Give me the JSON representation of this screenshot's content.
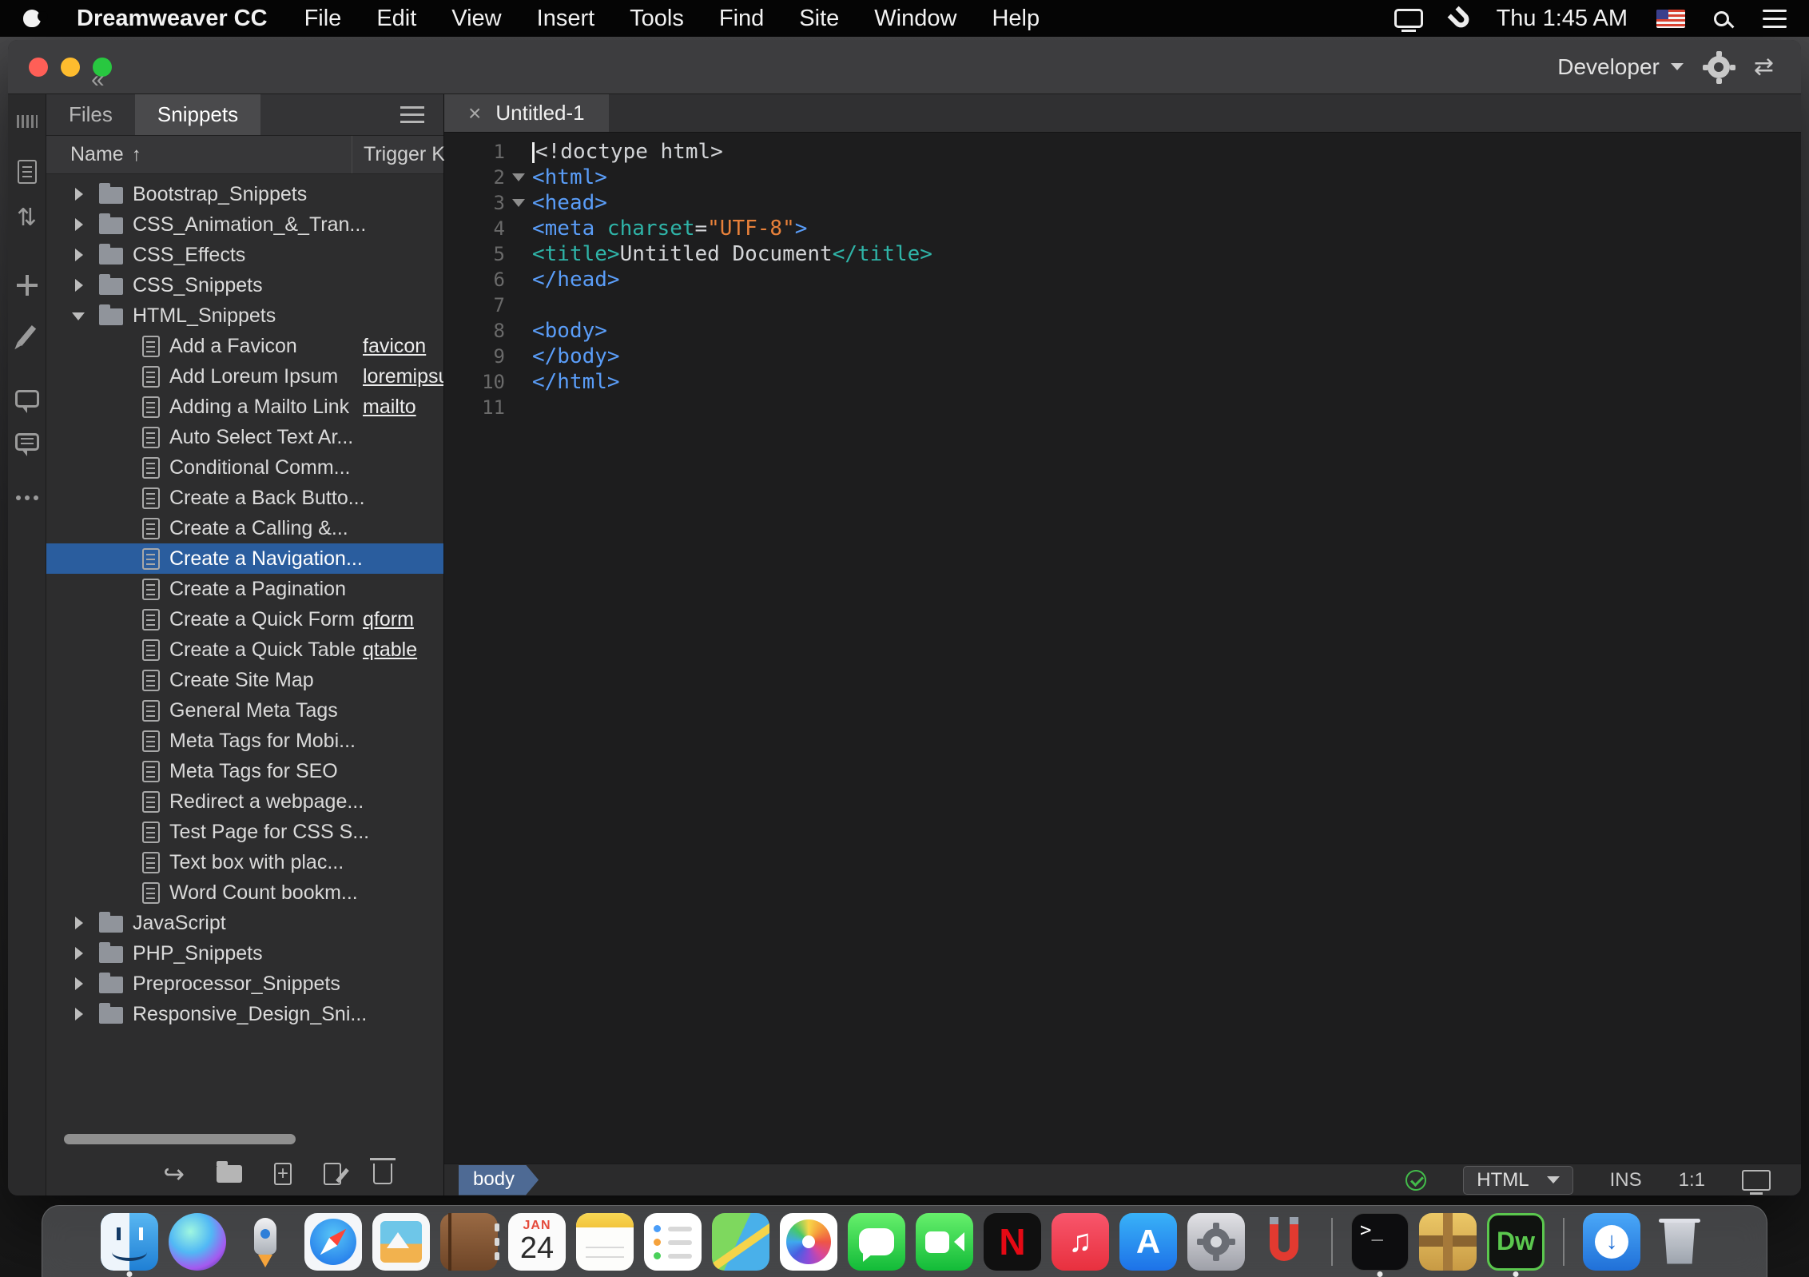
{
  "menubar": {
    "app_name": "Dreamweaver CC",
    "menus": [
      "File",
      "Edit",
      "View",
      "Insert",
      "Tools",
      "Find",
      "Site",
      "Window",
      "Help"
    ],
    "clock": "Thu 1:45 AM"
  },
  "window": {
    "workspace": "Developer"
  },
  "panel": {
    "tabs": {
      "files": "Files",
      "snippets": "Snippets"
    },
    "columns": {
      "name": "Name",
      "trigger": "Trigger Key"
    },
    "items": [
      {
        "kind": "folder",
        "label": "Bootstrap_Snippets"
      },
      {
        "kind": "folder",
        "label": "CSS_Animation_&_Tran..."
      },
      {
        "kind": "folder",
        "label": "CSS_Effects"
      },
      {
        "kind": "folder",
        "label": "CSS_Snippets"
      },
      {
        "kind": "folder-open",
        "label": "HTML_Snippets"
      },
      {
        "kind": "file",
        "label": "Add a Favicon",
        "trigger": "favicon"
      },
      {
        "kind": "file",
        "label": "Add Loreum Ipsum",
        "trigger": "loremipsum"
      },
      {
        "kind": "file",
        "label": "Adding a Mailto Link",
        "trigger": "mailto"
      },
      {
        "kind": "file",
        "label": "Auto Select Text Ar..."
      },
      {
        "kind": "file",
        "label": "Conditional Comm..."
      },
      {
        "kind": "file",
        "label": "Create a Back Butto..."
      },
      {
        "kind": "file",
        "label": "Create a Calling &..."
      },
      {
        "kind": "file",
        "label": "Create a Navigation...",
        "selected": true
      },
      {
        "kind": "file",
        "label": "Create a Pagination"
      },
      {
        "kind": "file",
        "label": "Create a Quick Form",
        "trigger": "qform"
      },
      {
        "kind": "file",
        "label": "Create a Quick Table",
        "trigger": "qtable"
      },
      {
        "kind": "file",
        "label": "Create Site Map"
      },
      {
        "kind": "file",
        "label": "General Meta Tags"
      },
      {
        "kind": "file",
        "label": "Meta Tags for Mobi..."
      },
      {
        "kind": "file",
        "label": "Meta Tags for SEO"
      },
      {
        "kind": "file",
        "label": "Redirect a webpage..."
      },
      {
        "kind": "file",
        "label": "Test Page for CSS S..."
      },
      {
        "kind": "file",
        "label": "Text box with plac..."
      },
      {
        "kind": "file",
        "label": "Word Count bookm..."
      },
      {
        "kind": "folder",
        "label": "JavaScript"
      },
      {
        "kind": "folder",
        "label": "PHP_Snippets"
      },
      {
        "kind": "folder",
        "label": "Preprocessor_Snippets"
      },
      {
        "kind": "folder",
        "label": "Responsive_Design_Sni..."
      }
    ]
  },
  "editor": {
    "tab": "Untitled-1",
    "gutter": [
      "1",
      "2",
      "3",
      "4",
      "5",
      "6",
      "7",
      "8",
      "9",
      "10",
      "11"
    ],
    "lines": [
      {
        "tokens": [
          {
            "t": "<!doctype html>",
            "c": "tok plain"
          }
        ]
      },
      {
        "fold": true,
        "tokens": [
          {
            "t": "<html>",
            "c": "tok tag"
          }
        ]
      },
      {
        "fold": true,
        "tokens": [
          {
            "t": "<head>",
            "c": "tok tag"
          }
        ]
      },
      {
        "tokens": [
          {
            "t": "<meta ",
            "c": "tok tag"
          },
          {
            "t": "charset",
            "c": "tok attr"
          },
          {
            "t": "=",
            "c": "tok plain"
          },
          {
            "t": "\"UTF-8\"",
            "c": "tok val"
          },
          {
            "t": ">",
            "c": "tok tag"
          }
        ]
      },
      {
        "tokens": [
          {
            "t": "<title>",
            "c": "tok attr"
          },
          {
            "t": "Untitled Document",
            "c": "tok plain"
          },
          {
            "t": "</title>",
            "c": "tok attr"
          }
        ]
      },
      {
        "tokens": [
          {
            "t": "</head>",
            "c": "tok tag"
          }
        ]
      },
      {
        "tokens": []
      },
      {
        "tokens": [
          {
            "t": "<body>",
            "c": "tok tag"
          }
        ]
      },
      {
        "tokens": [
          {
            "t": "</body>",
            "c": "tok tag"
          }
        ]
      },
      {
        "tokens": [
          {
            "t": "</html>",
            "c": "tok tag"
          }
        ]
      },
      {
        "tokens": []
      }
    ],
    "status": {
      "tag": "body",
      "syntax": "HTML",
      "mode": "INS",
      "caret": "1:1"
    }
  },
  "dock": {
    "calendar": {
      "month": "JAN",
      "day": "24"
    },
    "apps": [
      "finder",
      "siri",
      "launchpad",
      "safari",
      "preview",
      "contacts",
      "calendar",
      "notes",
      "reminders",
      "maps",
      "photos",
      "messages",
      "facetime",
      "netflix",
      "music",
      "app-store",
      "system-settings",
      "magnet",
      "terminal",
      "unarchiver",
      "dreamweaver",
      "downloads",
      "trash"
    ]
  }
}
